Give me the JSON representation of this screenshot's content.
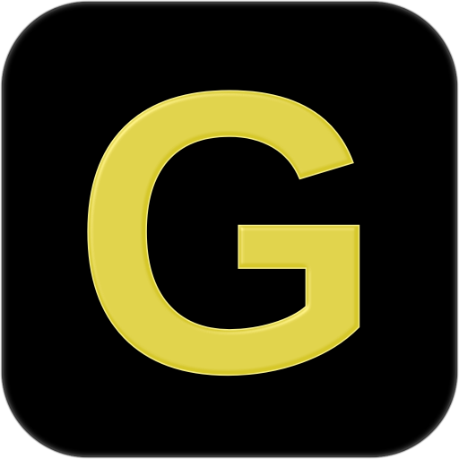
{
  "icon": {
    "letter": "G",
    "letter_color": "#d6c82a",
    "letter_edge_color": "#f4ec86",
    "background_color": "#000000"
  }
}
